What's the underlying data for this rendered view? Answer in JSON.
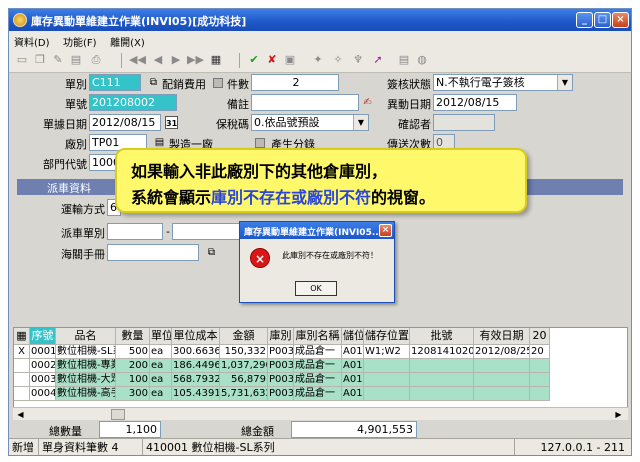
{
  "window": {
    "title": "庫存異動單維建立作業(INVI05)[成功科技]"
  },
  "menu": [
    "資料(D)",
    "功能(F)",
    "離開(X)"
  ],
  "form": {
    "doc_type_label": "單別",
    "doc_type_value": "C111",
    "cost_label": "配銷費用",
    "qty_label": "件數",
    "qty_value": "2",
    "sign_status_label": "簽核狀態",
    "sign_status_value": "N.不執行電子簽核",
    "doc_no_label": "單號",
    "doc_no_value": "201208002",
    "note_label": "備註",
    "note_value": "",
    "change_date_label": "異動日期",
    "change_date_value": "2012/08/15",
    "doc_date_label": "單據日期",
    "doc_date_value": "2012/08/15",
    "bond_label": "保稅碼",
    "bond_value": "0.依品號預設",
    "confirm_label": "確認者",
    "confirm_value": "",
    "factory_label": "廠別",
    "factory_value": "TP01",
    "factory_name": "製造一廠",
    "split_label": "產生分錄",
    "send_count_label": "傳送次數",
    "send_count_value": "0",
    "dept_label": "部門代號",
    "dept_value": "1000"
  },
  "section": {
    "title": "派車資料"
  },
  "dispatch": {
    "ship_label": "運輸方式",
    "ship_value": "6",
    "car_label": "派車單別",
    "customs_label": "海關手冊"
  },
  "callout": {
    "line1": "如果輸入非此廠別下的其他倉庫別，",
    "line2_a": "系統會顯示",
    "line2_b": "庫別不存在或廠別不符",
    "line2_c": "的視窗。"
  },
  "dialog": {
    "title": "庫存異動單維建立作業(INVI05...",
    "message": "此庫別不存在或廠別不符！",
    "ok_label": "OK"
  },
  "grid": {
    "columns": [
      "序號",
      "品名",
      "數量",
      "單位",
      "單位成本",
      "金額",
      "庫別",
      "庫別名稱",
      "儲位",
      "儲存位置",
      "批號",
      "有效日期",
      "20"
    ],
    "rows": [
      {
        "mark": "X",
        "cells": [
          "0001",
          "數位相機-SL系列",
          "500",
          "ea",
          "300.6636",
          "150,332",
          "P003",
          "成品倉一",
          "A01",
          "W1;W2",
          "120814102001",
          "2012/08/25",
          "20"
        ]
      },
      {
        "mark": "",
        "cells": [
          "0002",
          "數位相機-專業型",
          "200",
          "ea",
          "186.4496",
          "1,037,290",
          "P003",
          "成品倉一",
          "A01",
          "",
          "",
          "",
          ""
        ]
      },
      {
        "mark": "",
        "cells": [
          "0003",
          "數位相機-大眾型",
          "100",
          "ea",
          "568.7932",
          "56,879",
          "P003",
          "成品倉一",
          "A01",
          "",
          "",
          "",
          ""
        ]
      },
      {
        "mark": "",
        "cells": [
          "0004",
          "數位相機-高手玩",
          "300",
          "ea",
          "105.4391",
          "5,731,632",
          "P003",
          "成品倉一",
          "A01",
          "",
          "",
          "",
          ""
        ]
      }
    ]
  },
  "totals": {
    "qty_label": "總數量",
    "qty_value": "1,100",
    "amount_label": "總金額",
    "amount_value": "4,901,553"
  },
  "status": {
    "mode": "新增",
    "records": "單身資料筆數 4",
    "item": "410001 數位相機-SL系列",
    "host": "127.0.0.1 - 211"
  }
}
